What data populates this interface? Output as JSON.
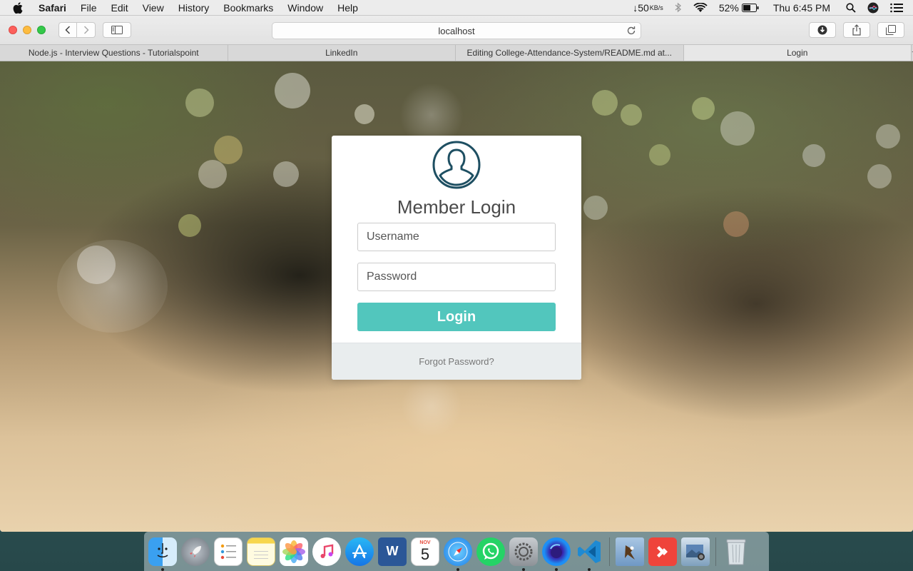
{
  "menubar": {
    "app_name": "Safari",
    "items": [
      "File",
      "Edit",
      "View",
      "History",
      "Bookmarks",
      "Window",
      "Help"
    ],
    "network_speed": "↓50",
    "network_unit": "KB/s",
    "battery_percent": "52%",
    "clock": "Thu 6:45 PM",
    "icons": [
      "apple-icon",
      "bluetooth-icon",
      "wifi-icon",
      "battery-icon",
      "spotlight-icon",
      "siri-icon",
      "notification-center-icon"
    ]
  },
  "browser": {
    "address": "localhost",
    "tabs": [
      {
        "title": "Node.js - Interview Questions - Tutorialspoint",
        "active": false
      },
      {
        "title": "LinkedIn",
        "active": false
      },
      {
        "title": "Editing College-Attendance-System/README.md at...",
        "active": false
      },
      {
        "title": "Login",
        "active": true
      }
    ],
    "new_tab_label": "+"
  },
  "login": {
    "title": "Member Login",
    "username_placeholder": "Username",
    "password_placeholder": "Password",
    "submit_label": "Login",
    "forgot_label": "Forgot Password?",
    "accent_color": "#52c6bd",
    "avatar_color": "#1e4f62"
  },
  "dock": {
    "calendar_month": "NOV",
    "calendar_day": "5",
    "apps": [
      "finder",
      "launchpad",
      "reminders",
      "notes",
      "photos",
      "itunes",
      "app-store",
      "word",
      "calendar",
      "safari",
      "whatsapp",
      "system-preferences",
      "firefox",
      "vscode",
      "preview-eagle",
      "anydesk",
      "image-capture",
      "trash"
    ]
  }
}
